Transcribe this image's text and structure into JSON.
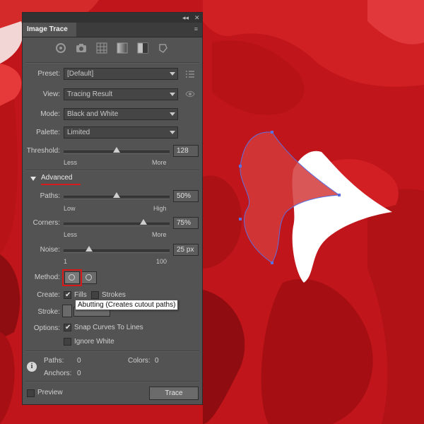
{
  "panel": {
    "tab_title": "Image Trace",
    "preset_icons": [
      "auto-color-icon",
      "high-color-icon",
      "low-color-icon",
      "grayscale-icon",
      "black-and-white-icon",
      "outline-icon"
    ],
    "preset": {
      "label": "Preset:",
      "value": "[Default]"
    },
    "view": {
      "label": "View:",
      "value": "Tracing Result"
    },
    "mode": {
      "label": "Mode:",
      "value": "Black and White"
    },
    "palette": {
      "label": "Palette:",
      "value": "Limited"
    },
    "threshold": {
      "label": "Threshold:",
      "value": "128",
      "min_label": "Less",
      "max_label": "More",
      "level": 0.5
    },
    "advanced": {
      "label": "Advanced",
      "expanded": true
    },
    "paths": {
      "label": "Paths:",
      "value": "50%",
      "min_label": "Low",
      "max_label": "High",
      "level": 0.5
    },
    "corners": {
      "label": "Corners:",
      "value": "75%",
      "min_label": "Less",
      "max_label": "More",
      "level": 0.75
    },
    "noise": {
      "label": "Noise:",
      "value": "25 px",
      "min_label": "1",
      "max_label": "100",
      "level": 0.24
    },
    "method": {
      "label": "Method:",
      "tooltip": "Abutting (Creates cutout paths)"
    },
    "create": {
      "label": "Create:",
      "fills_label": "Fills",
      "fills_checked": true,
      "strokes_label": "Strokes",
      "strokes_checked": false
    },
    "stroke": {
      "label": "Stroke:"
    },
    "options": {
      "label": "Options:",
      "snap_label": "Snap Curves To Lines",
      "snap_checked": true,
      "ignore_white_label": "Ignore White",
      "ignore_white_checked": false
    },
    "stats": {
      "paths_label": "Paths:",
      "paths_value": "0",
      "colors_label": "Colors:",
      "colors_value": "0",
      "anchors_label": "Anchors:",
      "anchors_value": "0"
    },
    "preview_label": "Preview",
    "trace_button": "Trace"
  },
  "colors": {
    "canvas_red": "#c4161b",
    "highlight_red": "#d61818",
    "selection_blue": "#5a6fe0"
  }
}
